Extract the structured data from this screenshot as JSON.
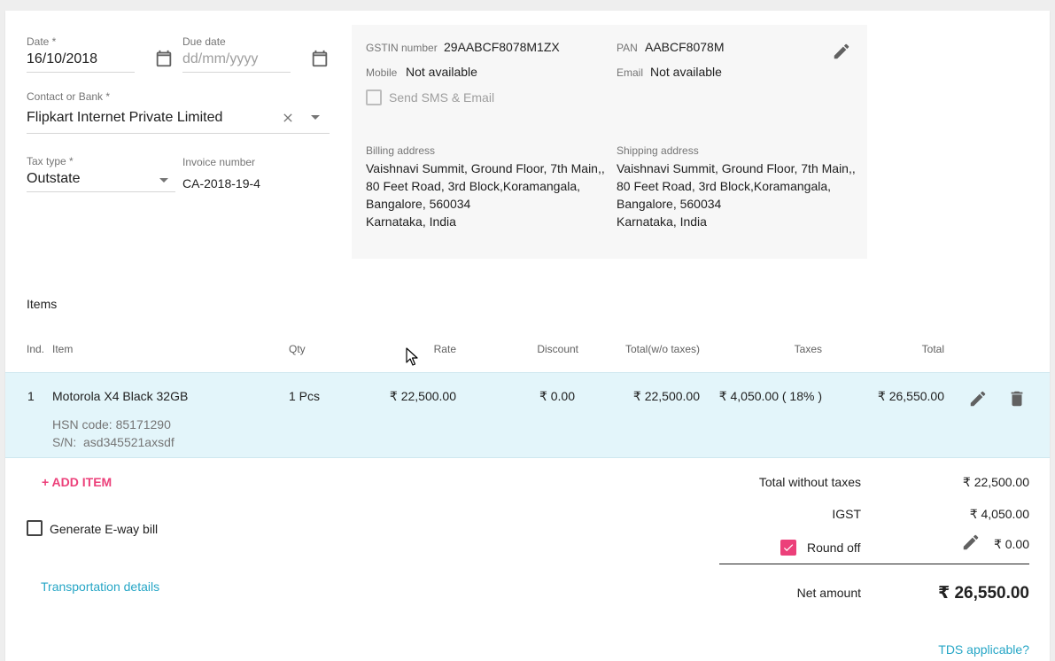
{
  "form": {
    "date_label": "Date *",
    "date_value": "16/10/2018",
    "due_label": "Due date",
    "due_placeholder": "dd/mm/yyyy",
    "contact_label": "Contact or Bank *",
    "contact_value": "Flipkart Internet Private Limited",
    "tax_type_label": "Tax type *",
    "tax_type_value": "Outstate",
    "invoice_label": "Invoice number",
    "invoice_value": "CA-2018-19-4"
  },
  "contact_panel": {
    "gstin_label": "GSTIN number",
    "gstin_value": "29AABCF8078M1ZX",
    "pan_label": "PAN",
    "pan_value": "AABCF8078M",
    "mobile_label": "Mobile",
    "mobile_value": "Not available",
    "email_label": "Email",
    "email_value": "Not available",
    "send_label": "Send SMS & Email",
    "billing_label": "Billing address",
    "billing_lines": [
      "Vaishnavi Summit, Ground Floor, 7th Main,,",
      "80 Feet Road, 3rd Block,Koramangala,",
      "Bangalore, 560034",
      "Karnataka, India"
    ],
    "shipping_label": "Shipping address",
    "shipping_lines": [
      "Vaishnavi Summit, Ground Floor, 7th Main,,",
      "80 Feet Road, 3rd Block,Koramangala,",
      "Bangalore, 560034",
      "Karnataka, India"
    ]
  },
  "items": {
    "heading": "Items",
    "columns": {
      "ind": "Ind.",
      "item": "Item",
      "qty": "Qty",
      "rate": "Rate",
      "discount": "Discount",
      "total_wo": "Total(w/o taxes)",
      "taxes": "Taxes",
      "total": "Total"
    },
    "rows": [
      {
        "ind": "1",
        "name": "Motorola X4 Black 32GB",
        "qty": "1 Pcs",
        "rate": "₹ 22,500.00",
        "discount": "₹ 0.00",
        "total_wo": "₹ 22,500.00",
        "taxes": "₹ 4,050.00 ( 18% )",
        "total": "₹ 26,550.00",
        "hsn": "HSN code: 85171290",
        "sn": "S/N:  asd345521axsdf"
      }
    ]
  },
  "actions": {
    "add_item": "+ ADD ITEM",
    "eway_label": "Generate E-way bill",
    "transport": "Transportation details",
    "tds": "TDS applicable?"
  },
  "totals": {
    "without_tax_label": "Total without taxes",
    "without_tax_value": "₹ 22,500.00",
    "igst_label": "IGST",
    "igst_value": "₹ 4,050.00",
    "round_label": "Round off",
    "round_value": "₹ 0.00",
    "net_label": "Net amount",
    "net_value": "₹ 26,550.00"
  },
  "colors": {
    "accent_pink": "#ec407a",
    "link_teal": "#26a6c6",
    "row_highlight": "#e3f5fa"
  }
}
